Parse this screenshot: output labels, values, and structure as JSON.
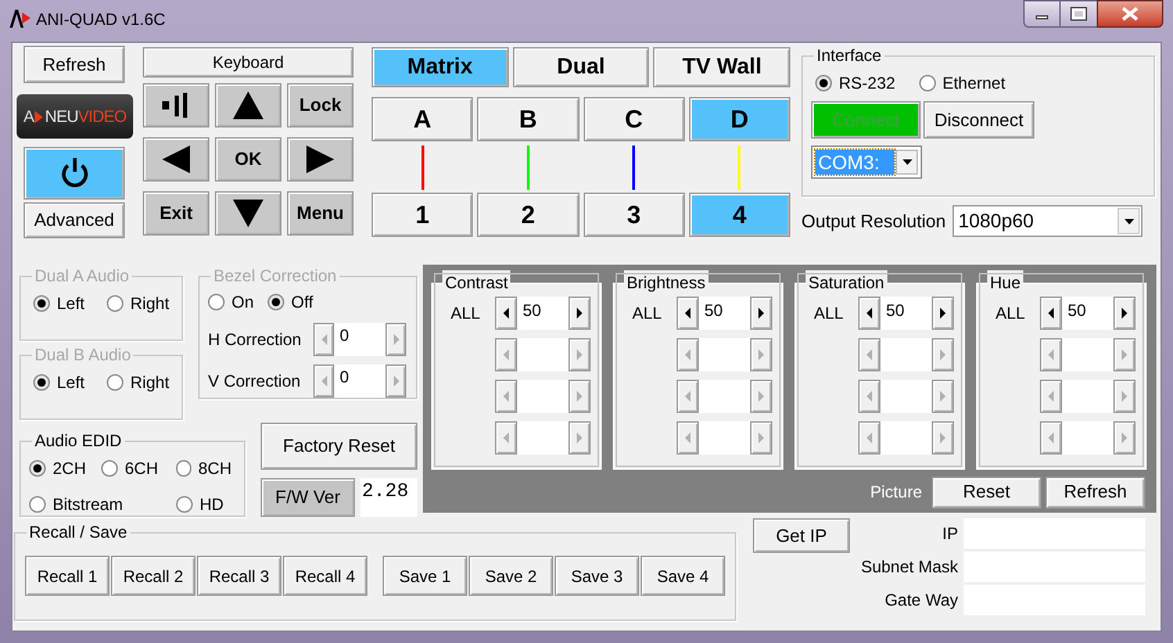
{
  "window": {
    "title": "ANI-QUAD v1.6C"
  },
  "refresh_button": "Refresh",
  "logo": {
    "parts": [
      "A",
      "NEU",
      "VIDEO"
    ]
  },
  "power": {
    "on": true
  },
  "advanced_button": "Advanced",
  "keyboard": {
    "title": "Keyboard",
    "keys": [
      {
        "kind": "bars"
      },
      {
        "kind": "up"
      },
      {
        "kind": "text",
        "label": "Lock"
      },
      {
        "kind": "left"
      },
      {
        "kind": "text",
        "label": "OK"
      },
      {
        "kind": "right"
      },
      {
        "kind": "text",
        "label": "Exit"
      },
      {
        "kind": "down"
      },
      {
        "kind": "text",
        "label": "Menu"
      }
    ]
  },
  "modes": [
    {
      "label": "Matrix",
      "selected": true
    },
    {
      "label": "Dual",
      "selected": false
    },
    {
      "label": "TV Wall",
      "selected": false
    }
  ],
  "inputs": [
    {
      "label": "A",
      "selected": false
    },
    {
      "label": "B",
      "selected": false
    },
    {
      "label": "C",
      "selected": false
    },
    {
      "label": "D",
      "selected": true
    }
  ],
  "links": [
    {
      "color": "#ff0000"
    },
    {
      "color": "#00ff00"
    },
    {
      "color": "#0000ff"
    },
    {
      "color": "#ffff00"
    }
  ],
  "outputs": [
    {
      "label": "1",
      "selected": false
    },
    {
      "label": "2",
      "selected": false
    },
    {
      "label": "3",
      "selected": false
    },
    {
      "label": "4",
      "selected": true
    }
  ],
  "interface": {
    "title": "Interface",
    "options": [
      {
        "label": "RS-232",
        "selected": true
      },
      {
        "label": "Ethernet",
        "selected": false
      }
    ],
    "connect": {
      "label": "Connect",
      "disabled": true
    },
    "disconnect": "Disconnect",
    "port": "COM3:"
  },
  "output_resolution": {
    "label": "Output Resolution",
    "value": "1080p60"
  },
  "dual_a_audio": {
    "title": "Dual A Audio",
    "disabled": true,
    "options": [
      {
        "label": "Left",
        "selected": true
      },
      {
        "label": "Right",
        "selected": false
      }
    ]
  },
  "dual_b_audio": {
    "title": "Dual B Audio",
    "disabled": true,
    "options": [
      {
        "label": "Left",
        "selected": true
      },
      {
        "label": "Right",
        "selected": false
      }
    ]
  },
  "bezel_correction": {
    "title": "Bezel Correction",
    "disabled": true,
    "options": [
      {
        "label": "On",
        "selected": false
      },
      {
        "label": "Off",
        "selected": true
      }
    ],
    "fields": [
      {
        "label": "H Correction",
        "value": "0"
      },
      {
        "label": "V Correction",
        "value": "0"
      }
    ]
  },
  "audio_edid": {
    "title": "Audio EDID",
    "options": [
      {
        "label": "2CH",
        "selected": true
      },
      {
        "label": "6CH",
        "selected": false
      },
      {
        "label": "8CH",
        "selected": false
      },
      {
        "label": "Bitstream",
        "selected": false
      },
      {
        "label": "HD",
        "selected": false
      }
    ]
  },
  "factory_reset": "Factory Reset",
  "firmware": {
    "button": "F/W Ver",
    "version": "2.28"
  },
  "picture": {
    "groups": [
      {
        "title": "Contrast",
        "rows": [
          {
            "label": "ALL",
            "value": "50",
            "enabled": true
          },
          {
            "enabled": false
          },
          {
            "enabled": false
          },
          {
            "enabled": false
          }
        ]
      },
      {
        "title": "Brightness",
        "rows": [
          {
            "label": "ALL",
            "value": "50",
            "enabled": true
          },
          {
            "enabled": false
          },
          {
            "enabled": false
          },
          {
            "enabled": false
          }
        ]
      },
      {
        "title": "Saturation",
        "rows": [
          {
            "label": "ALL",
            "value": "50",
            "enabled": true
          },
          {
            "enabled": false
          },
          {
            "enabled": false
          },
          {
            "enabled": false
          }
        ]
      },
      {
        "title": "Hue",
        "rows": [
          {
            "label": "ALL",
            "value": "50",
            "enabled": true
          },
          {
            "enabled": false
          },
          {
            "enabled": false
          },
          {
            "enabled": false
          }
        ]
      }
    ],
    "label": "Picture",
    "reset": "Reset",
    "refresh": "Refresh"
  },
  "recall_save": {
    "title": "Recall / Save",
    "recall": [
      "Recall 1",
      "Recall 2",
      "Recall 3",
      "Recall 4"
    ],
    "save": [
      "Save 1",
      "Save 2",
      "Save 3",
      "Save 4"
    ]
  },
  "network": {
    "get_ip": "Get IP",
    "fields": [
      {
        "label": "IP"
      },
      {
        "label": "Subnet Mask"
      },
      {
        "label": "Gate Way"
      }
    ]
  }
}
